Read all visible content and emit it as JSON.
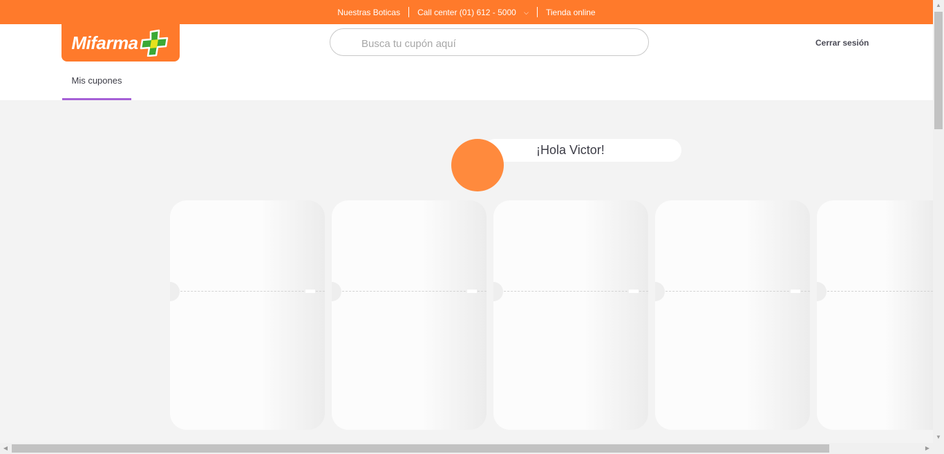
{
  "topbar": {
    "links": [
      "Nuestras Boticas",
      "Call center (01) 612 - 5000",
      "Tienda online"
    ],
    "chevron": "chevron-down-icon"
  },
  "header": {
    "logo_text": "Mifarma",
    "search": {
      "placeholder": "Busca tu cupón aquí",
      "value": ""
    },
    "logout_label": "Cerrar sesión",
    "tab_label": "Mis cupones"
  },
  "greeting": "¡Hola Victor!",
  "colors": {
    "brand_orange": "#ff7a2b",
    "avatar": "#ff8a3d",
    "tab_underline": "#a55fd6",
    "logo_plus_green": "#3aa935",
    "logo_plus_yellow": "#e6e21e"
  }
}
